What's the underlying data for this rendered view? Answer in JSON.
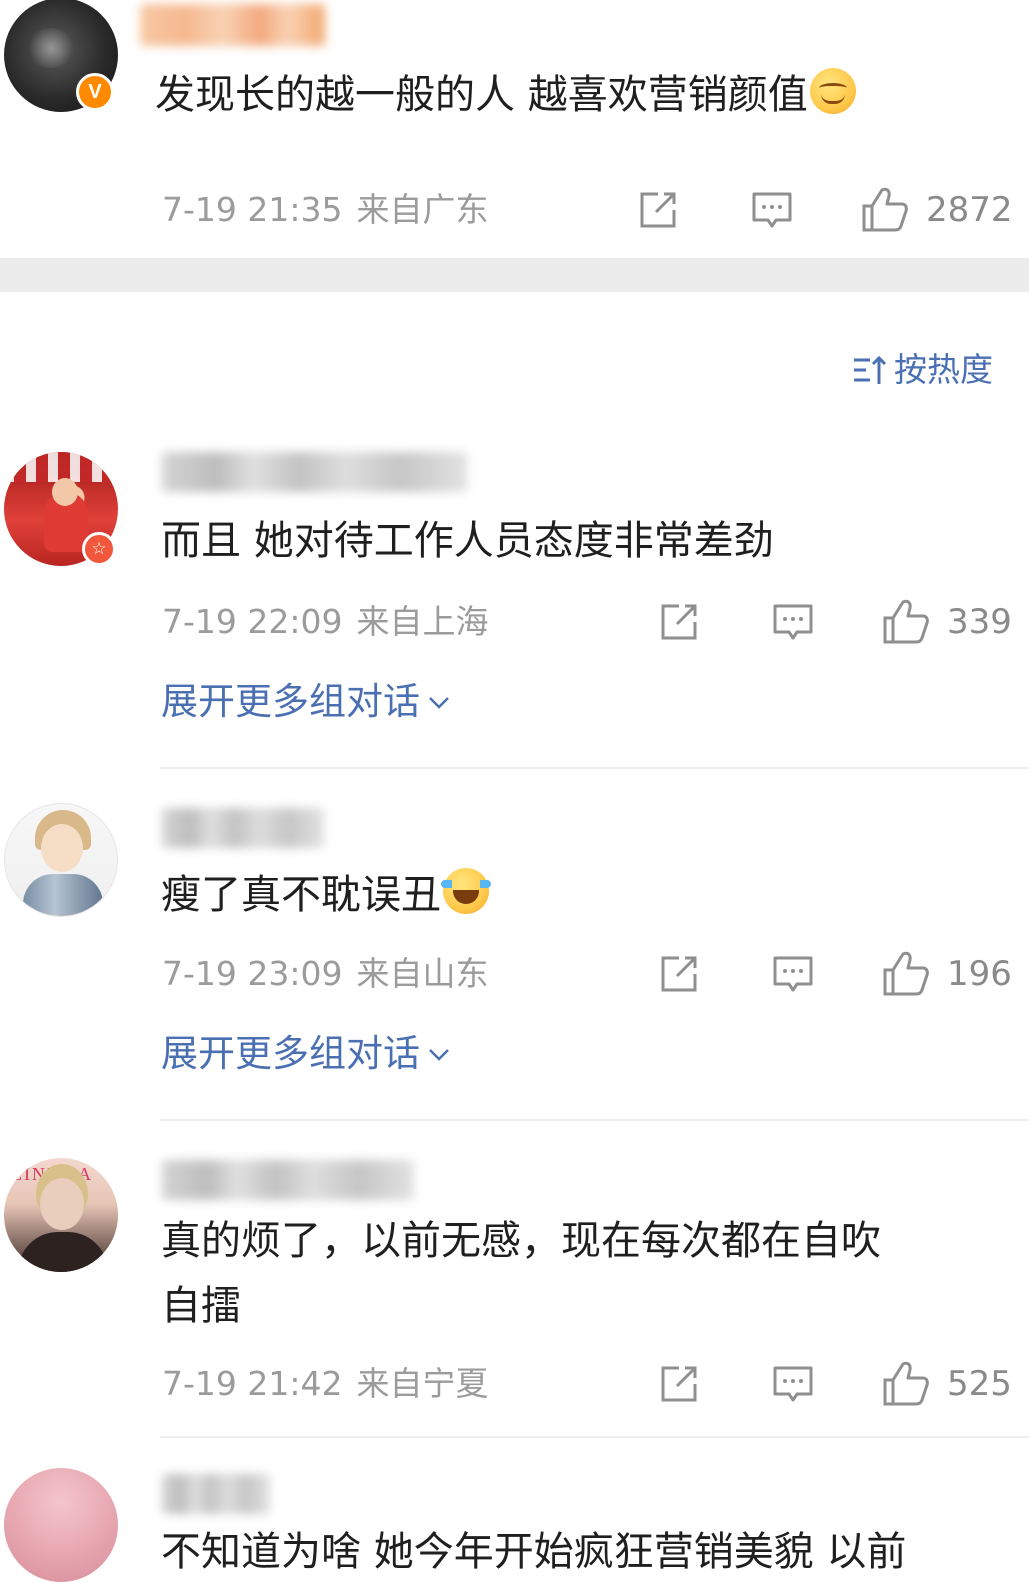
{
  "sort": {
    "label": "按热度"
  },
  "comments": [
    {
      "text": "发现长的越一般的人 越喜欢营销颜值",
      "emoji": "smile-emoji",
      "date": "7-19 21:35",
      "source": "来自广东",
      "likes": "2872",
      "badge": "V"
    },
    {
      "text": "而且 她对待工作人员态度非常差劲",
      "date": "7-19 22:09",
      "source": "来自上海",
      "likes": "339",
      "expand_label": "展开更多组对话",
      "badge": "☆"
    },
    {
      "text": "瘦了真不耽误丑",
      "emoji": "laugh-cry-emoji",
      "date": "7-19 23:09",
      "source": "来自山东",
      "likes": "196",
      "expand_label": "展开更多组对话"
    },
    {
      "text_line1": "真的烦了，以前无感，现在每次都在自吹",
      "text_line2": "自擂",
      "date": "7-19 21:42",
      "source": "来自宁夏",
      "likes": "525",
      "avatar_text": "CINEMA"
    },
    {
      "text": "不知道为啥 她今年开始疯狂营销美貌 以前"
    }
  ],
  "colors": {
    "link": "#4a6fb3",
    "meta": "#9b9b9b",
    "vip_badge": "#ff8a00",
    "separator": "#ececec"
  }
}
